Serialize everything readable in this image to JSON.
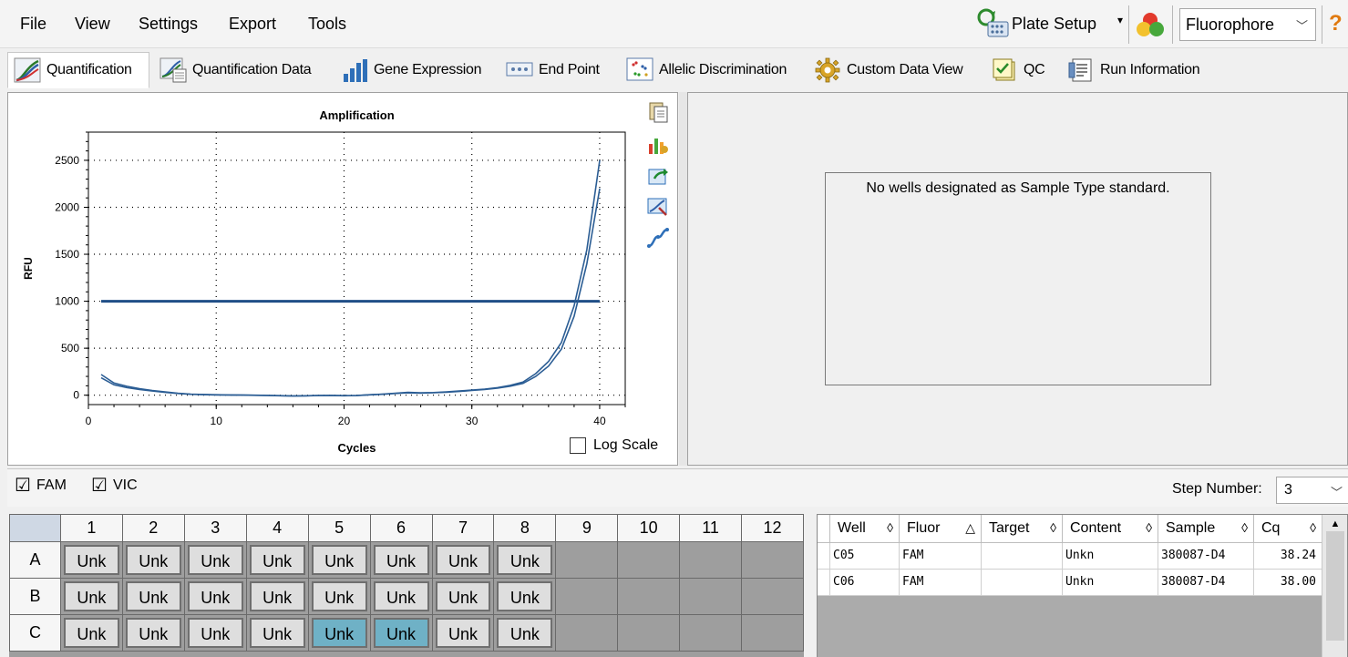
{
  "menu": {
    "file": "File",
    "view": "View",
    "settings": "Settings",
    "export": "Export",
    "tools": "Tools"
  },
  "toolbar_right": {
    "plate_setup": "Plate Setup",
    "caret": "▾",
    "fluorophore": "Fluorophore",
    "help": "?"
  },
  "tabs": [
    {
      "label": "Quantification",
      "icon": "amplification-curve-icon"
    },
    {
      "label": "Quantification Data",
      "icon": "amplification-data-icon"
    },
    {
      "label": "Gene Expression",
      "icon": "bar-chart-icon"
    },
    {
      "label": "End Point",
      "icon": "end-point-icon"
    },
    {
      "label": "Allelic Discrimination",
      "icon": "scatter-plot-icon"
    },
    {
      "label": "Custom Data View",
      "icon": "gear-icon"
    },
    {
      "label": "QC",
      "icon": "qc-checklist-icon"
    },
    {
      "label": "Run Information",
      "icon": "run-information-icon"
    }
  ],
  "chart_data": {
    "type": "line",
    "title": "Amplification",
    "xlabel": "Cycles",
    "ylabel": "RFU",
    "xlim": [
      0,
      42
    ],
    "ylim": [
      -100,
      2800
    ],
    "xticks": [
      0,
      10,
      20,
      30,
      40
    ],
    "yticks": [
      0,
      500,
      1000,
      1500,
      2000,
      2500
    ],
    "grid": true,
    "threshold": 1000,
    "series": [
      {
        "x": [
          1,
          2,
          3,
          4,
          5,
          6,
          7,
          8,
          9,
          10,
          11,
          12,
          13,
          14,
          15,
          16,
          17,
          18,
          19,
          20,
          21,
          22,
          23,
          24,
          25,
          26,
          27,
          28,
          29,
          30,
          31,
          32,
          33,
          34,
          35,
          36,
          37,
          38,
          39,
          40
        ],
        "y": [
          220,
          130,
          95,
          70,
          50,
          35,
          20,
          12,
          8,
          5,
          3,
          2,
          0,
          -2,
          -5,
          -8,
          -6,
          -3,
          -2,
          -5,
          -3,
          5,
          12,
          20,
          30,
          25,
          28,
          35,
          45,
          55,
          65,
          80,
          105,
          140,
          230,
          360,
          560,
          950,
          1550,
          2500
        ]
      },
      {
        "x": [
          1,
          2,
          3,
          4,
          5,
          6,
          7,
          8,
          9,
          10,
          11,
          12,
          13,
          14,
          15,
          16,
          17,
          18,
          19,
          20,
          21,
          22,
          23,
          24,
          25,
          26,
          27,
          28,
          29,
          30,
          31,
          32,
          33,
          34,
          35,
          36,
          37,
          38,
          39,
          40
        ],
        "y": [
          185,
          110,
          80,
          60,
          45,
          30,
          18,
          10,
          6,
          3,
          2,
          1,
          -1,
          -3,
          -6,
          -9,
          -7,
          -4,
          -3,
          -6,
          -4,
          4,
          10,
          18,
          25,
          22,
          26,
          32,
          40,
          50,
          60,
          75,
          95,
          125,
          200,
          310,
          490,
          840,
          1400,
          2200
        ]
      }
    ],
    "colors": {
      "series": "#2b5d94",
      "threshold": "#1f4e87"
    }
  },
  "log_scale_label": "Log Scale",
  "standard_message": "No wells designated as Sample Type standard.",
  "filters": [
    {
      "label": "FAM",
      "checked": "☑"
    },
    {
      "label": "VIC",
      "checked": "☑"
    }
  ],
  "step": {
    "label": "Step Number:",
    "value": "3"
  },
  "plate": {
    "columns": [
      "1",
      "2",
      "3",
      "4",
      "5",
      "6",
      "7",
      "8",
      "9",
      "10",
      "11",
      "12"
    ],
    "rows": [
      {
        "label": "A",
        "wells": [
          "Unk",
          "Unk",
          "Unk",
          "Unk",
          "Unk",
          "Unk",
          "Unk",
          "Unk"
        ]
      },
      {
        "label": "B",
        "wells": [
          "Unk",
          "Unk",
          "Unk",
          "Unk",
          "Unk",
          "Unk",
          "Unk",
          "Unk"
        ]
      },
      {
        "label": "C",
        "wells": [
          "Unk",
          "Unk",
          "Unk",
          "Unk",
          "Unk",
          "Unk",
          "Unk",
          "Unk"
        ],
        "selected": [
          4,
          5
        ]
      }
    ]
  },
  "results": {
    "headers": [
      {
        "label": "Well",
        "sort": "◊"
      },
      {
        "label": "Fluor",
        "sort": "△"
      },
      {
        "label": "Target",
        "sort": "◊"
      },
      {
        "label": "Content",
        "sort": "◊"
      },
      {
        "label": "Sample",
        "sort": "◊"
      },
      {
        "label": "Cq",
        "sort": "◊"
      }
    ],
    "rows": [
      [
        "C05",
        "FAM",
        "",
        "Unkn",
        "380087-D4",
        "38.24"
      ],
      [
        "C06",
        "FAM",
        "",
        "Unkn",
        "380087-D4",
        "38.00"
      ]
    ]
  }
}
